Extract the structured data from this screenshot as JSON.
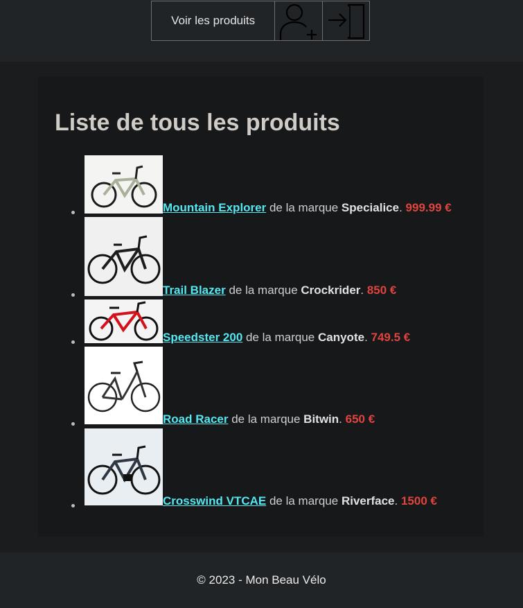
{
  "nav": {
    "products_label": "Voir les produits",
    "icons": [
      "add-user-icon",
      "login-icon"
    ]
  },
  "page": {
    "title": "Liste de tous les produits"
  },
  "products": [
    {
      "name": "Mountain Explorer",
      "connector": " de la marque ",
      "brand": "Specialice",
      "price": "999.99 €",
      "image": "mountain-bike-sage-image"
    },
    {
      "name": "Trail Blazer",
      "connector": " de la marque ",
      "brand": "Crockrider",
      "price": "850 €",
      "image": "mountain-bike-black-image"
    },
    {
      "name": "Speedster 200",
      "connector": " de la marque ",
      "brand": "Canyote",
      "price": "749.5 €",
      "image": "mountain-bike-red-image"
    },
    {
      "name": "Road Racer",
      "connector": " de la marque ",
      "brand": "Bitwin",
      "price": "650 €",
      "image": "city-bike-step-through-image"
    },
    {
      "name": "Crosswind VTCAE",
      "connector": " de la marque ",
      "brand": "Riverface",
      "price": "1500 €",
      "image": "electric-hybrid-bike-image"
    }
  ],
  "footer": {
    "text": "© 2023 - Mon Beau Vélo"
  },
  "colors": {
    "link": "#55e7f0",
    "price": "#e0443e",
    "background": "#1b1c1e",
    "card": "#17181a"
  }
}
